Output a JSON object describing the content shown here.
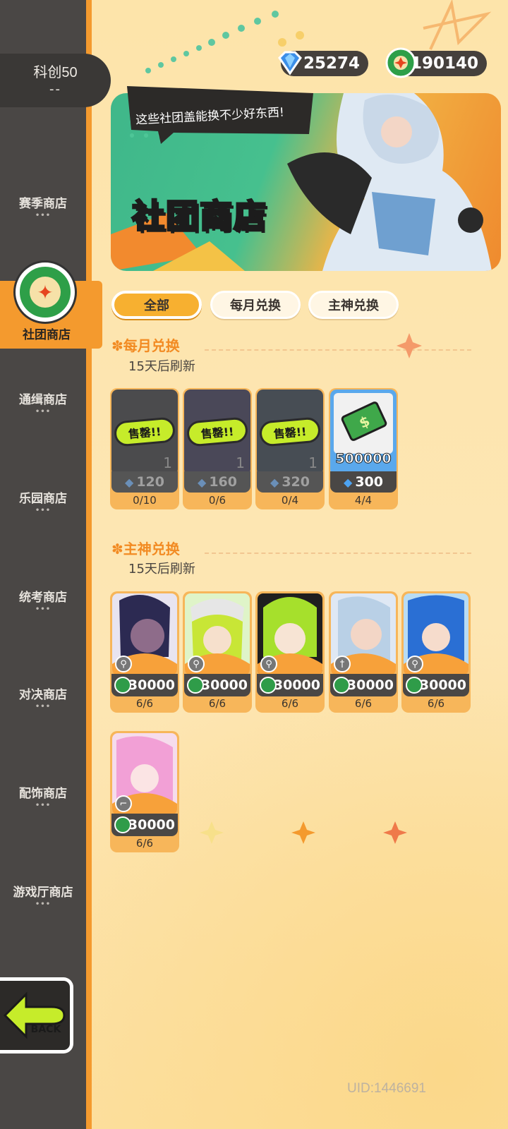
{
  "player": {
    "name": "科创50",
    "sub": "--"
  },
  "currency": {
    "gems": "25274",
    "tokens": "190140"
  },
  "sidebar": {
    "items": [
      {
        "label": "赛季商店"
      },
      {
        "label": "社团商店",
        "active": true
      },
      {
        "label": "通缉商店"
      },
      {
        "label": "乐园商店"
      },
      {
        "label": "统考商店"
      },
      {
        "label": "对决商店"
      },
      {
        "label": "配饰商店"
      },
      {
        "label": "游戏厅商店"
      }
    ],
    "dots": "•••",
    "back_label": "BACK"
  },
  "banner": {
    "title": "社团商店",
    "speech": "这些社团盖能换不少好东西!"
  },
  "tabs": [
    {
      "label": "全部",
      "active": true
    },
    {
      "label": "每月兑换"
    },
    {
      "label": "主神兑换"
    }
  ],
  "monthly": {
    "title": "每月兑换",
    "refresh": "15天后刷新",
    "items": [
      {
        "status": "售罄!!",
        "qty": "1",
        "price": "120",
        "count": "0/10"
      },
      {
        "status": "售罄!!",
        "qty": "1",
        "price": "160",
        "count": "0/6"
      },
      {
        "status": "售罄!!",
        "qty": "1",
        "price": "320",
        "count": "0/4"
      },
      {
        "status": "",
        "amount": "500000",
        "price": "300",
        "count": "4/4"
      }
    ]
  },
  "gods": {
    "title": "主神兑换",
    "refresh": "15天后刷新",
    "items": [
      {
        "price": "30000",
        "count": "6/6",
        "hair": "#2c2a52",
        "bg": "#e8e4f0"
      },
      {
        "price": "30000",
        "count": "6/6",
        "hair": "#c8e636",
        "bg": "#dff4c8"
      },
      {
        "price": "30000",
        "count": "6/6",
        "hair": "#a6e02c",
        "bg": "#1f1f1f"
      },
      {
        "price": "30000",
        "count": "6/6",
        "hair": "#b9d0e6",
        "bg": "#dfe8f4"
      },
      {
        "price": "30000",
        "count": "6/6",
        "hair": "#2a6fd4",
        "bg": "#b8dcf4"
      },
      {
        "price": "30000",
        "count": "6/6",
        "hair": "#f2a0d6",
        "bg": "#f6dcec"
      }
    ]
  },
  "uid": "UID:1446691",
  "colors": {
    "accent": "#f49a2e",
    "sidebar": "#4a4745",
    "bg": "#fde4a8"
  }
}
